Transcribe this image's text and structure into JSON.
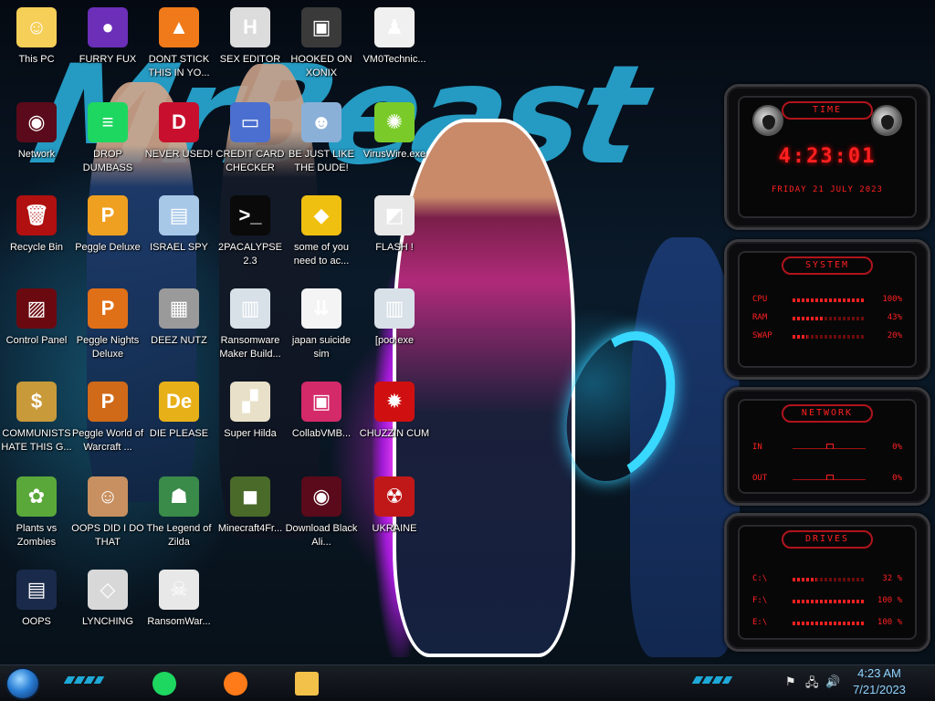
{
  "desktop_icons": [
    {
      "label": "This PC",
      "color": "#f6cf58",
      "glyph": "☺"
    },
    {
      "label": "FURRY FUX",
      "color": "#6b2fb8",
      "glyph": "●"
    },
    {
      "label": "DONT STICK THIS IN YO...",
      "color": "#f07a1a",
      "glyph": "▲"
    },
    {
      "label": "SEX EDITOR",
      "color": "#dcdcdc",
      "glyph": "H"
    },
    {
      "label": "HOOKED ON XONIX",
      "color": "#3a3a3a",
      "glyph": "▣"
    },
    {
      "label": "VM0Technic...",
      "color": "#f0f0f0",
      "glyph": "♟"
    },
    {
      "label": "Network",
      "color": "#5a0a1a",
      "glyph": "◉"
    },
    {
      "label": "DROP DUMBASS",
      "color": "#1ed760",
      "glyph": "≡"
    },
    {
      "label": "NEVER USED!",
      "color": "#c8102e",
      "glyph": "D"
    },
    {
      "label": "CREDIT CARD CHECKER",
      "color": "#4a6fd0",
      "glyph": "▭"
    },
    {
      "label": "BE JUST LIKE THE DUDE!",
      "color": "#8ab0d8",
      "glyph": "☻"
    },
    {
      "label": "VirusWire.exe",
      "color": "#7acb2a",
      "glyph": "✺"
    },
    {
      "label": "Recycle Bin",
      "color": "#b01010",
      "glyph": "🗑"
    },
    {
      "label": "Peggle Deluxe",
      "color": "#f0a020",
      "glyph": "P"
    },
    {
      "label": "ISRAEL SPY",
      "color": "#a8c8e8",
      "glyph": "▤"
    },
    {
      "label": "2PACALYPSE 2.3",
      "color": "#0a0a0a",
      "glyph": ">_"
    },
    {
      "label": "some of you need to ac...",
      "color": "#f0c010",
      "glyph": "◆"
    },
    {
      "label": "FLASH !",
      "color": "#e8e8e8",
      "glyph": "◩"
    },
    {
      "label": "Control Panel",
      "color": "#6a0a10",
      "glyph": "▨"
    },
    {
      "label": "Peggle Nights Deluxe",
      "color": "#e07018",
      "glyph": "P"
    },
    {
      "label": "DEEZ NUTZ",
      "color": "#9a9a9a",
      "glyph": "▦"
    },
    {
      "label": "Ransomware Maker Build...",
      "color": "#d8e0e8",
      "glyph": "▥"
    },
    {
      "label": "japan suicide sim",
      "color": "#f4f4f4",
      "glyph": "⇊"
    },
    {
      "label": "[poo.exe",
      "color": "#d8e0e8",
      "glyph": "▥"
    },
    {
      "label": "COMMUNISTS HATE THIS G...",
      "color": "#c89a3a",
      "glyph": "$"
    },
    {
      "label": "Peggle World of Warcraft ...",
      "color": "#d06a18",
      "glyph": "P"
    },
    {
      "label": "DIE PLEASE",
      "color": "#e8b018",
      "glyph": "De"
    },
    {
      "label": "Super Hilda",
      "color": "#e8e0c8",
      "glyph": "▞"
    },
    {
      "label": "CollabVMB...",
      "color": "#d42a6a",
      "glyph": "▣"
    },
    {
      "label": "CHUZZIN CUM",
      "color": "#d01010",
      "glyph": "✹"
    },
    {
      "label": "Plants vs Zombies",
      "color": "#5aa83a",
      "glyph": "✿"
    },
    {
      "label": "OOPS DID I DO THAT",
      "color": "#c89060",
      "glyph": "☺"
    },
    {
      "label": "The Legend of Zilda",
      "color": "#3a8a4a",
      "glyph": "☗"
    },
    {
      "label": "Minecraft4Fr...",
      "color": "#4a6a2a",
      "glyph": "◼"
    },
    {
      "label": "Download Black Ali...",
      "color": "#5a0a1a",
      "glyph": "◉"
    },
    {
      "label": "UKRAINE",
      "color": "#c01818",
      "glyph": "☢"
    },
    {
      "label": "OOPS",
      "color": "#1a2a4a",
      "glyph": "▤"
    },
    {
      "label": "LYNCHING",
      "color": "#d8d8d8",
      "glyph": "◇"
    },
    {
      "label": "RansomWar...",
      "color": "#e8e8e8",
      "glyph": "☠"
    }
  ],
  "gadgets": {
    "time": {
      "title": "TIME",
      "clock": "4:23:01",
      "date": "FRIDAY 21 JULY 2023"
    },
    "system": {
      "title": "SYSTEM",
      "rows": [
        {
          "label": "CPU",
          "value": "100%",
          "level": 1.0
        },
        {
          "label": "RAM",
          "value": "43%",
          "level": 0.43
        },
        {
          "label": "SWAP",
          "value": "20%",
          "level": 0.2
        }
      ]
    },
    "network": {
      "title": "NETWORK",
      "rows": [
        {
          "label": "IN",
          "value": "0%"
        },
        {
          "label": "OUT",
          "value": "0%"
        }
      ]
    },
    "drives": {
      "title": "DRIVES",
      "rows": [
        {
          "label": "C:\\",
          "value": "32 %",
          "level": 0.32
        },
        {
          "label": "F:\\",
          "value": "100 %",
          "level": 1.0
        },
        {
          "label": "E:\\",
          "value": "100 %",
          "level": 1.0
        }
      ]
    }
  },
  "taskbar": {
    "apps": [
      {
        "name": "spotify",
        "color": "#1ed760"
      },
      {
        "name": "firefox",
        "color": "#ff7a18"
      },
      {
        "name": "file-explorer",
        "color": "#f2c14a"
      }
    ],
    "tray": {
      "flag": "⚑",
      "network": "🖧",
      "volume": "🔊",
      "time": "4:23 AM",
      "date": "7/21/2023"
    }
  },
  "colors": {
    "accent_red": "#ff2020",
    "accent_cyan": "#1ea9d8",
    "clock_blue": "#8fd3ff"
  }
}
